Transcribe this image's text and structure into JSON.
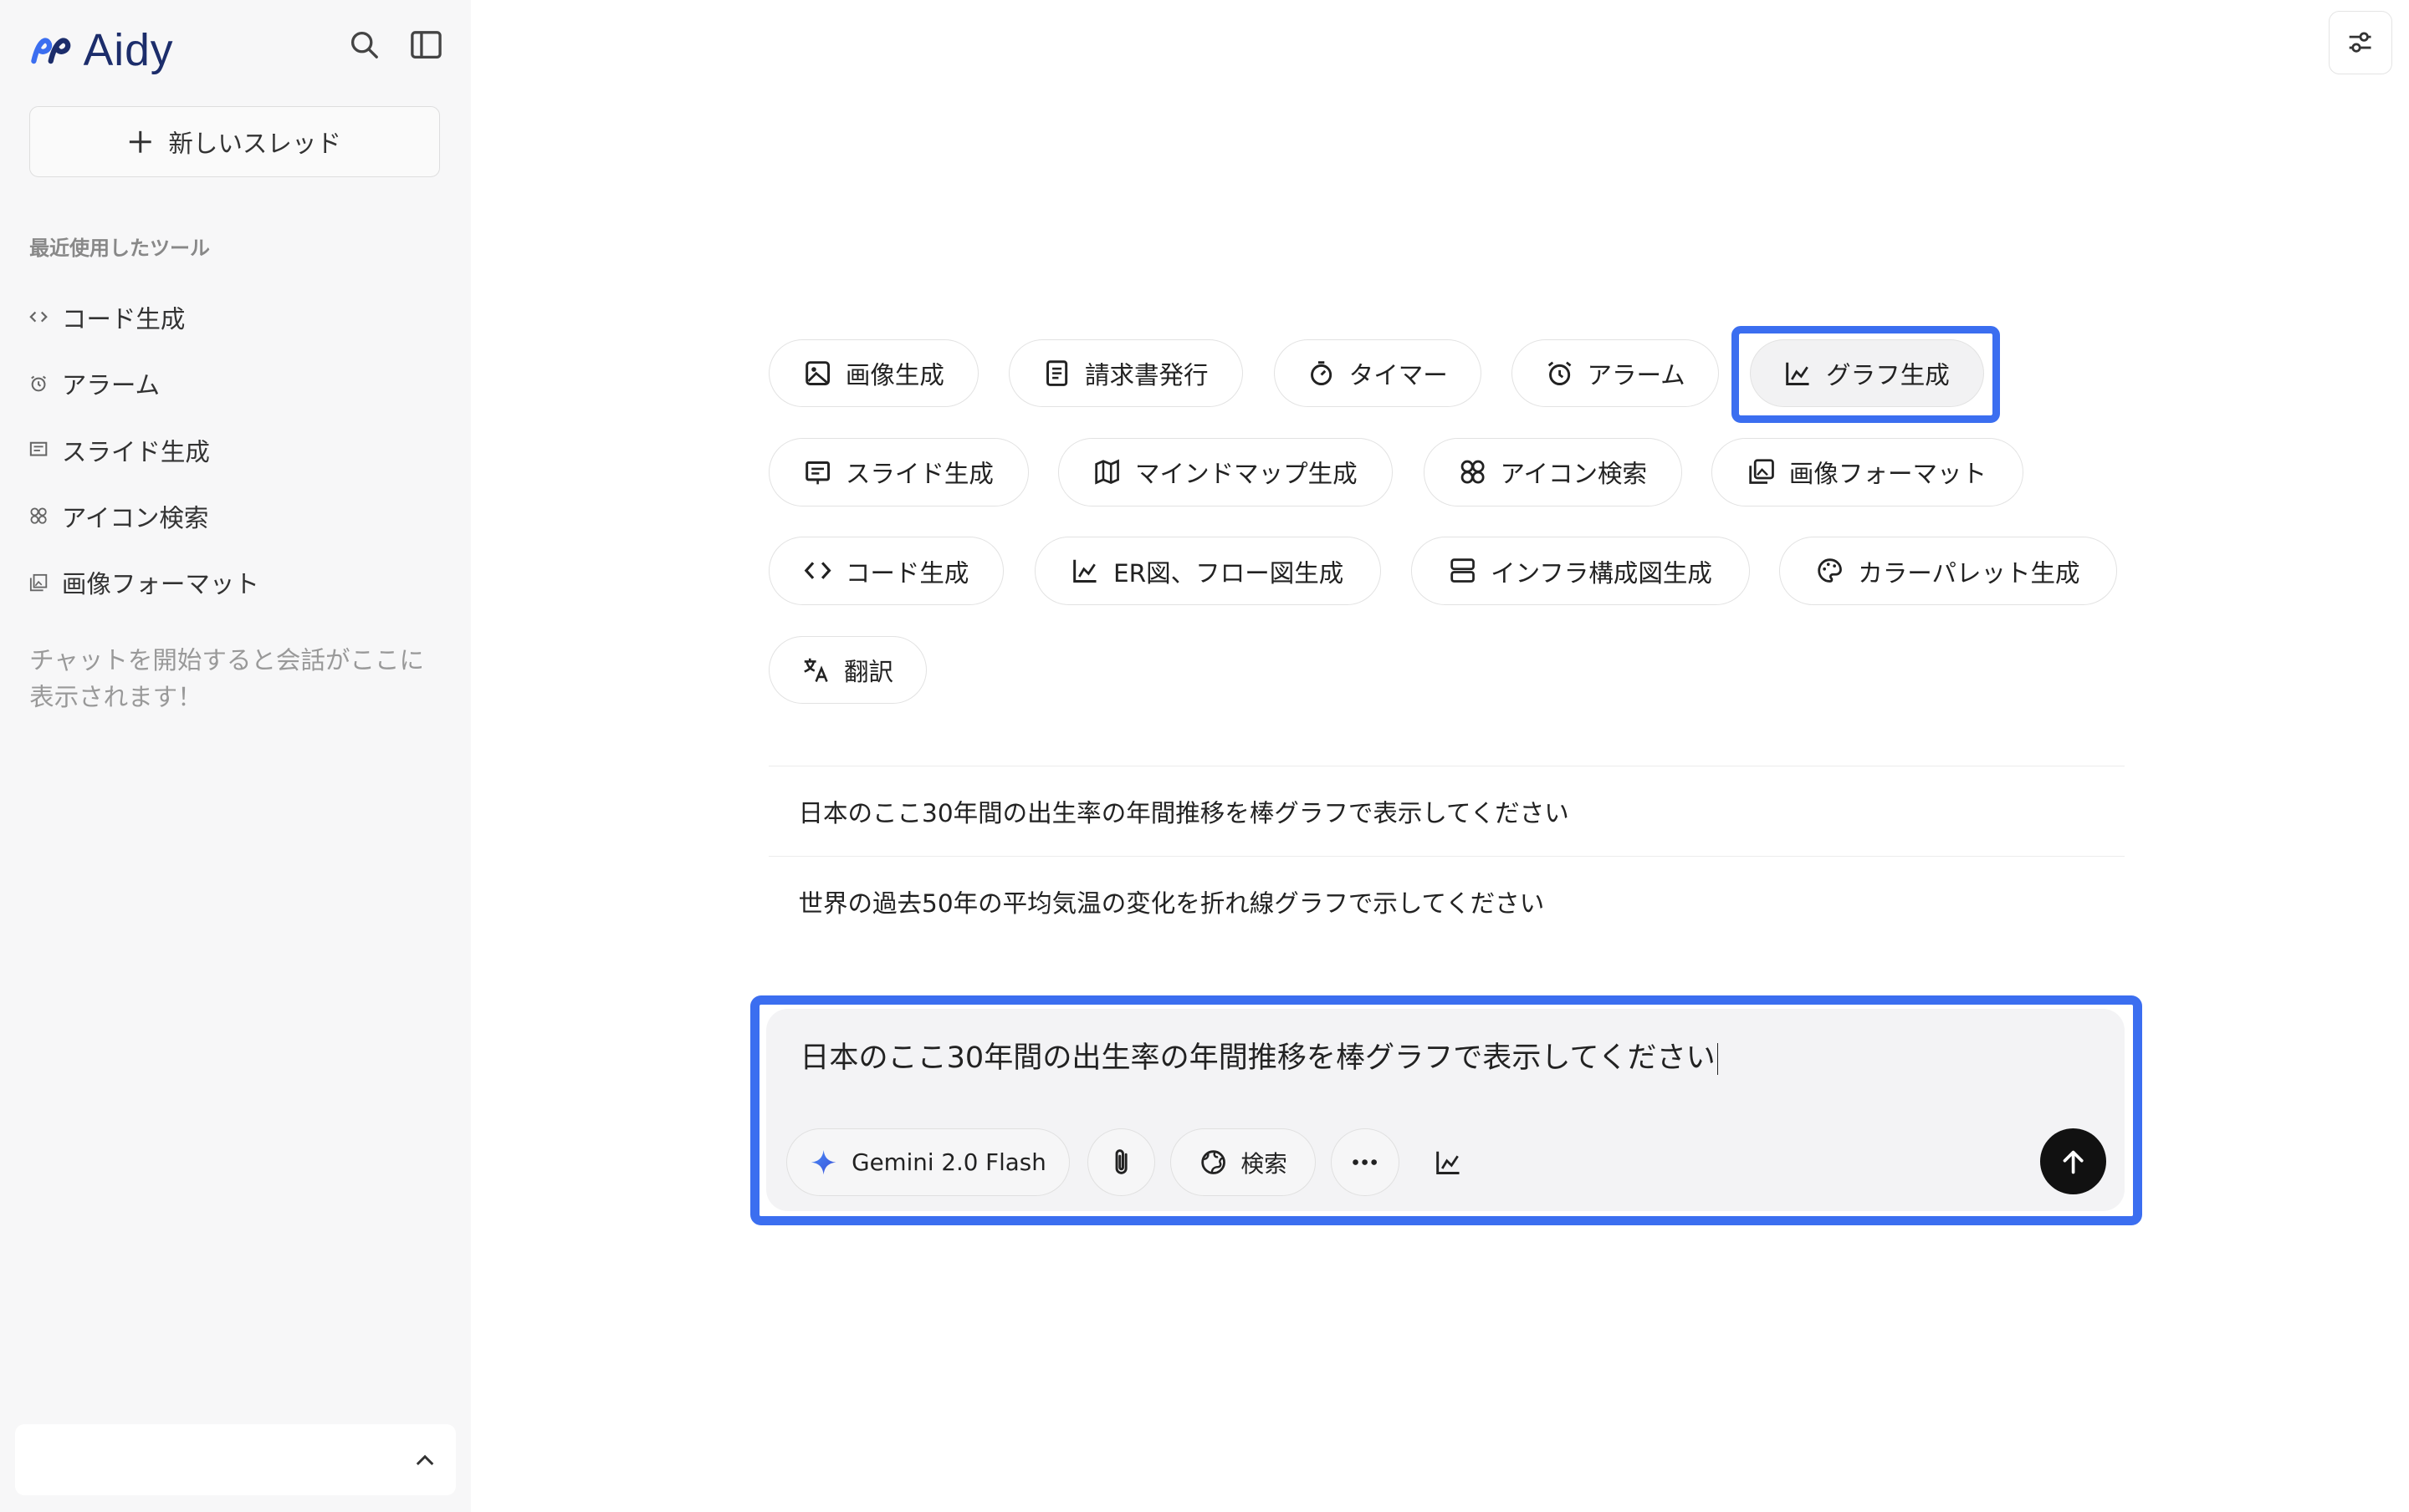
{
  "sidebar": {
    "brand": "Aidy",
    "new_thread_label": "新しいスレッド",
    "recent_title": "最近使用したツール",
    "recent_items": [
      {
        "label": "コード生成",
        "icon": "code-icon"
      },
      {
        "label": "アラーム",
        "icon": "alarm-icon"
      },
      {
        "label": "スライド生成",
        "icon": "slide-icon"
      },
      {
        "label": "アイコン検索",
        "icon": "icon-search-icon"
      },
      {
        "label": "画像フォーマット",
        "icon": "image-format-icon"
      }
    ],
    "hint": "チャットを開始すると会話がここに表示されます！"
  },
  "tools": [
    {
      "label": "画像生成",
      "icon": "image-icon"
    },
    {
      "label": "請求書発行",
      "icon": "invoice-icon"
    },
    {
      "label": "タイマー",
      "icon": "timer-icon"
    },
    {
      "label": "アラーム",
      "icon": "alarm-icon"
    },
    {
      "label": "グラフ生成",
      "icon": "chart-icon",
      "selected": true
    },
    {
      "label": "スライド生成",
      "icon": "slide-icon"
    },
    {
      "label": "マインドマップ生成",
      "icon": "map-icon"
    },
    {
      "label": "アイコン検索",
      "icon": "icon-search-icon"
    },
    {
      "label": "画像フォーマット",
      "icon": "image-format-icon"
    },
    {
      "label": "コード生成",
      "icon": "code-icon"
    },
    {
      "label": "ER図、フロー図生成",
      "icon": "chart-icon"
    },
    {
      "label": "インフラ構成図生成",
      "icon": "server-icon"
    },
    {
      "label": "カラーパレット生成",
      "icon": "palette-icon"
    },
    {
      "label": "翻訳",
      "icon": "translate-icon"
    }
  ],
  "suggestions": [
    "日本のここ30年間の出生率の年間推移を棒グラフで表示してください",
    "世界の過去50年の平均気温の変化を折れ線グラフで示してください"
  ],
  "composer": {
    "text": "日本のここ30年間の出生率の年間推移を棒グラフで表示してください",
    "model_label": "Gemini 2.0 Flash",
    "search_label": "検索"
  },
  "colors": {
    "accent_highlight": "#3b6ef0",
    "brand": "#1c2d6b",
    "send_button": "#111111"
  }
}
